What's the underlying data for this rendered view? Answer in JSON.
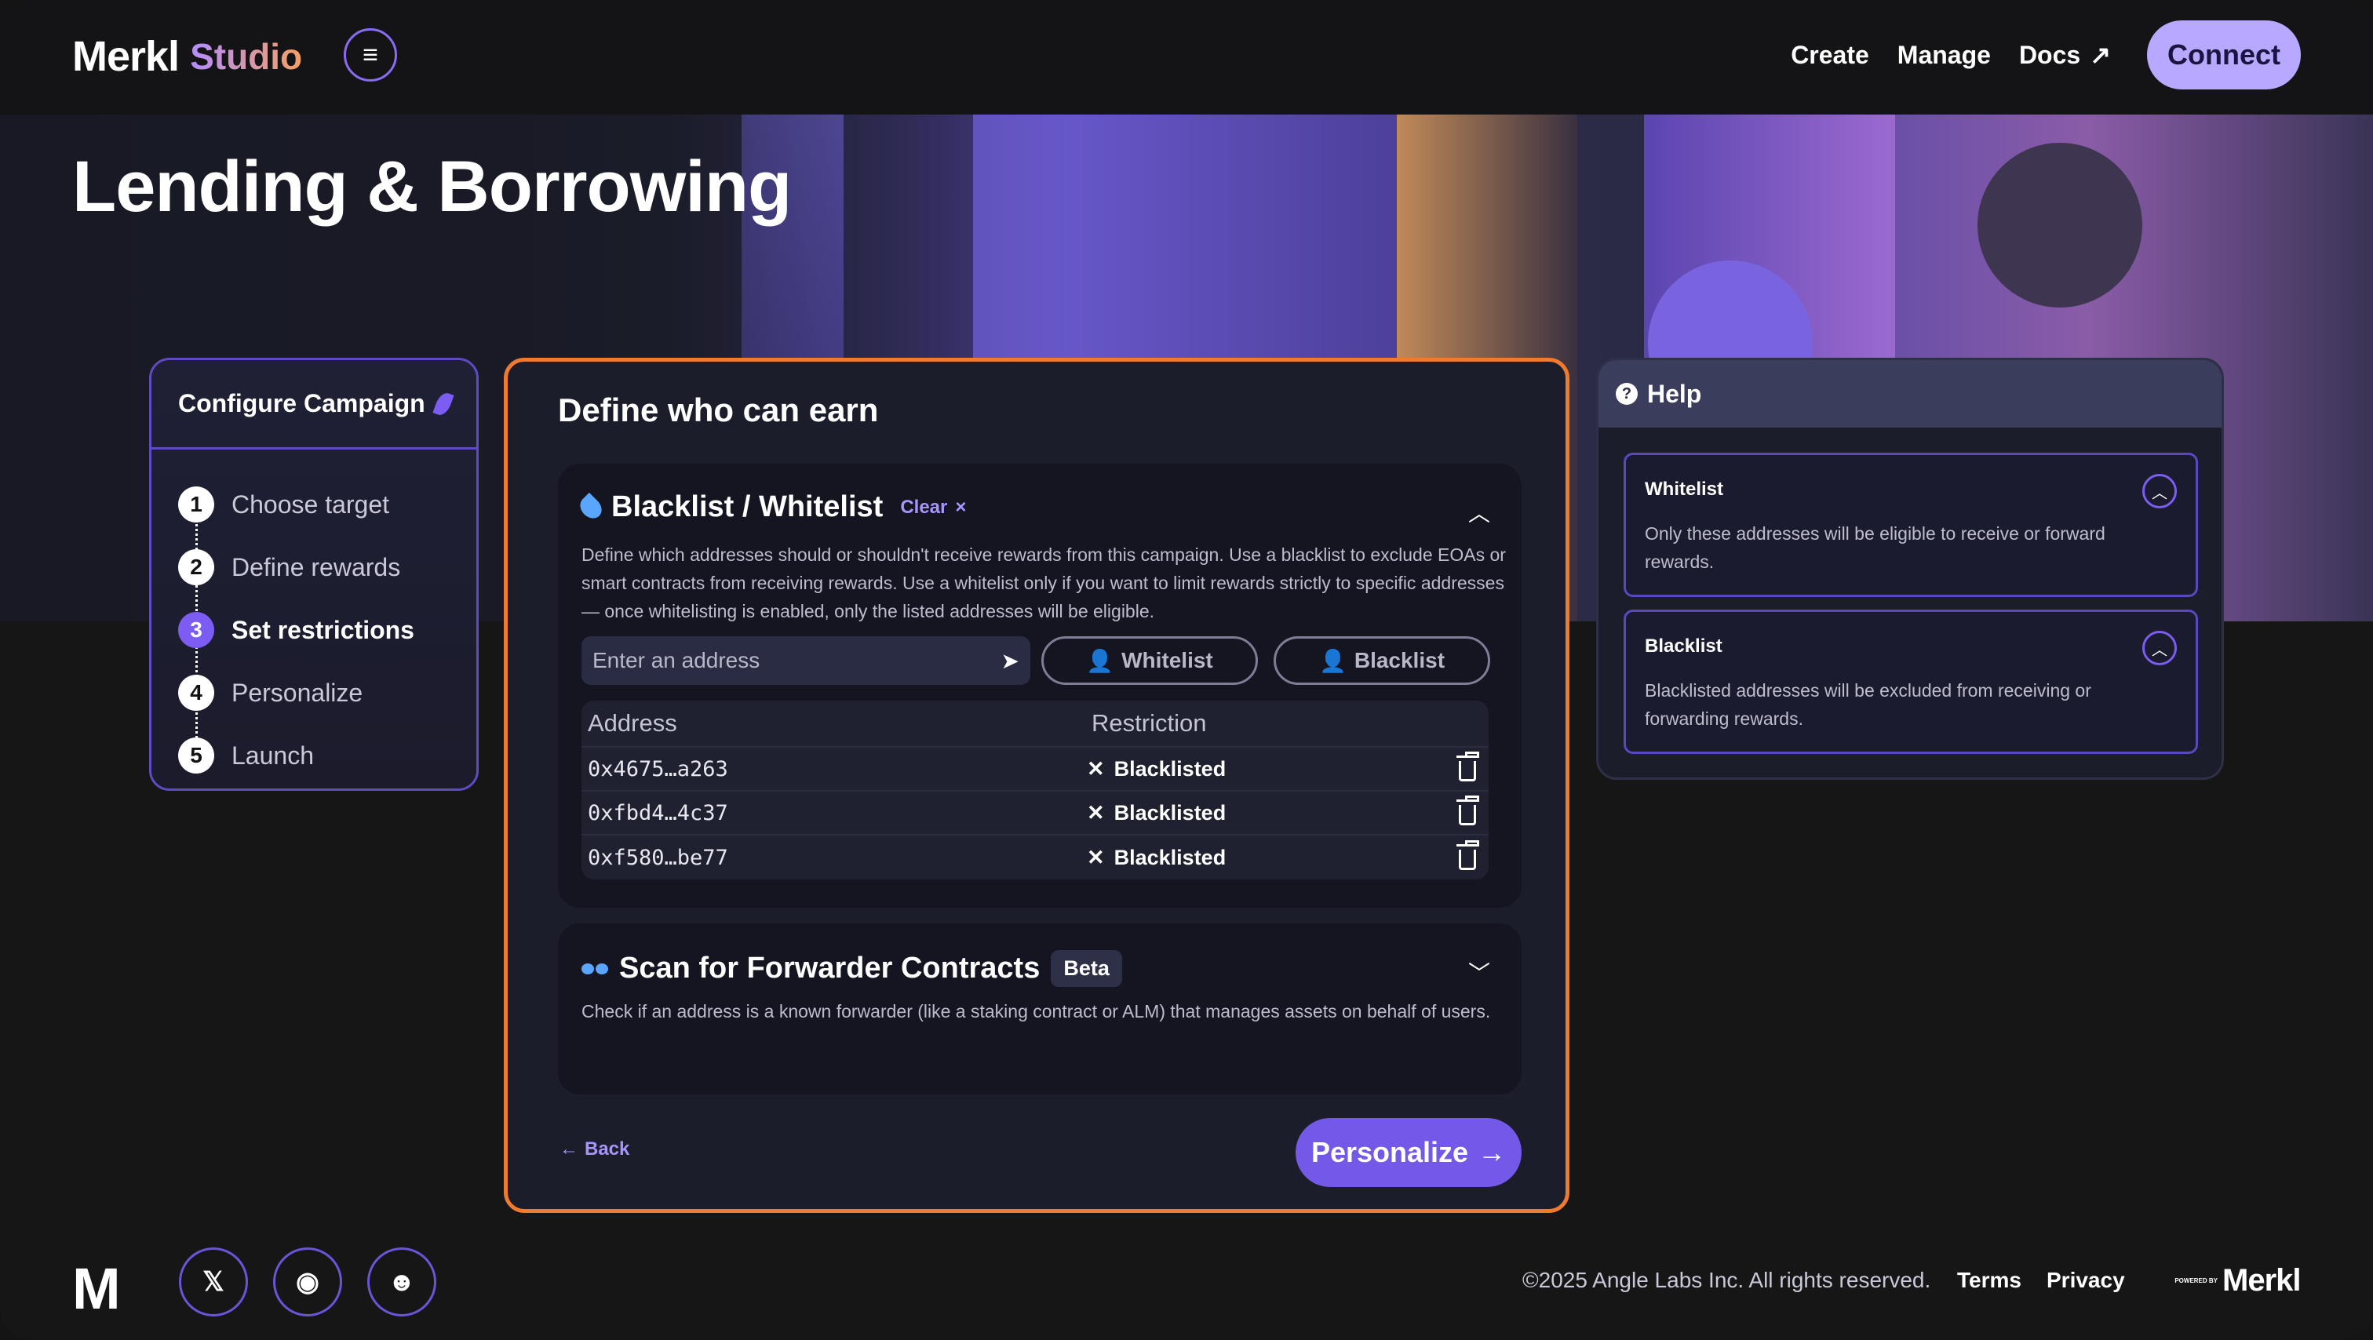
{
  "header": {
    "brand": "Merkl",
    "studio": "Studio",
    "menu_icon": "hamburger-menu-icon",
    "nav": {
      "create": "Create",
      "manage": "Manage",
      "docs": "Docs",
      "docs_icon": "↗"
    },
    "connect": "Connect"
  },
  "page": {
    "title": "Lending & Borrowing"
  },
  "steps": {
    "title": "Configure Campaign",
    "items": [
      {
        "num": "1",
        "label": "Choose target"
      },
      {
        "num": "2",
        "label": "Define rewards"
      },
      {
        "num": "3",
        "label": "Set restrictions"
      },
      {
        "num": "4",
        "label": "Personalize"
      },
      {
        "num": "5",
        "label": "Launch"
      }
    ],
    "active_index": 2
  },
  "main": {
    "title": "Define who can earn",
    "blacklist_section": {
      "title": "Blacklist / Whitelist",
      "clear": "Clear",
      "clear_icon": "×",
      "description": "Define which addresses should or shouldn't receive rewards from this campaign. Use a blacklist to exclude EOAs or smart contracts from receiving rewards. Use a whitelist only if you want to limit rewards strictly to specific addresses — once whitelisting is enabled, only the listed addresses will be eligible.",
      "input_placeholder": "Enter an address",
      "whitelist_button": "Whitelist",
      "blacklist_button": "Blacklist",
      "table": {
        "headers": [
          "Address",
          "Restriction"
        ],
        "rows": [
          {
            "address": "0x4675…a263",
            "restriction": "Blacklisted"
          },
          {
            "address": "0xfbd4…4c37",
            "restriction": "Blacklisted"
          },
          {
            "address": "0xf580…be77",
            "restriction": "Blacklisted"
          }
        ]
      }
    },
    "forwarder_section": {
      "title": "Scan for Forwarder Contracts",
      "badge": "Beta",
      "description": "Check if an address is a known forwarder (like a staking contract or ALM) that manages assets on behalf of users."
    },
    "back": "Back",
    "next": "Personalize"
  },
  "help": {
    "title": "Help",
    "items": [
      {
        "title": "Whitelist",
        "description": "Only these addresses will be eligible to receive or forward rewards."
      },
      {
        "title": "Blacklist",
        "description": "Blacklisted addresses will be excluded from receiving or forwarding rewards."
      }
    ]
  },
  "footer": {
    "copyright": "©2025 Angle Labs Inc. All rights reserved.",
    "terms": "Terms",
    "privacy": "Privacy",
    "powered_by": "POWERED BY",
    "powered_brand": "Merkl"
  },
  "colors": {
    "accent": "#7458e8",
    "highlight_border": "#f07a2e",
    "connect_bg": "#b9a8ff"
  }
}
